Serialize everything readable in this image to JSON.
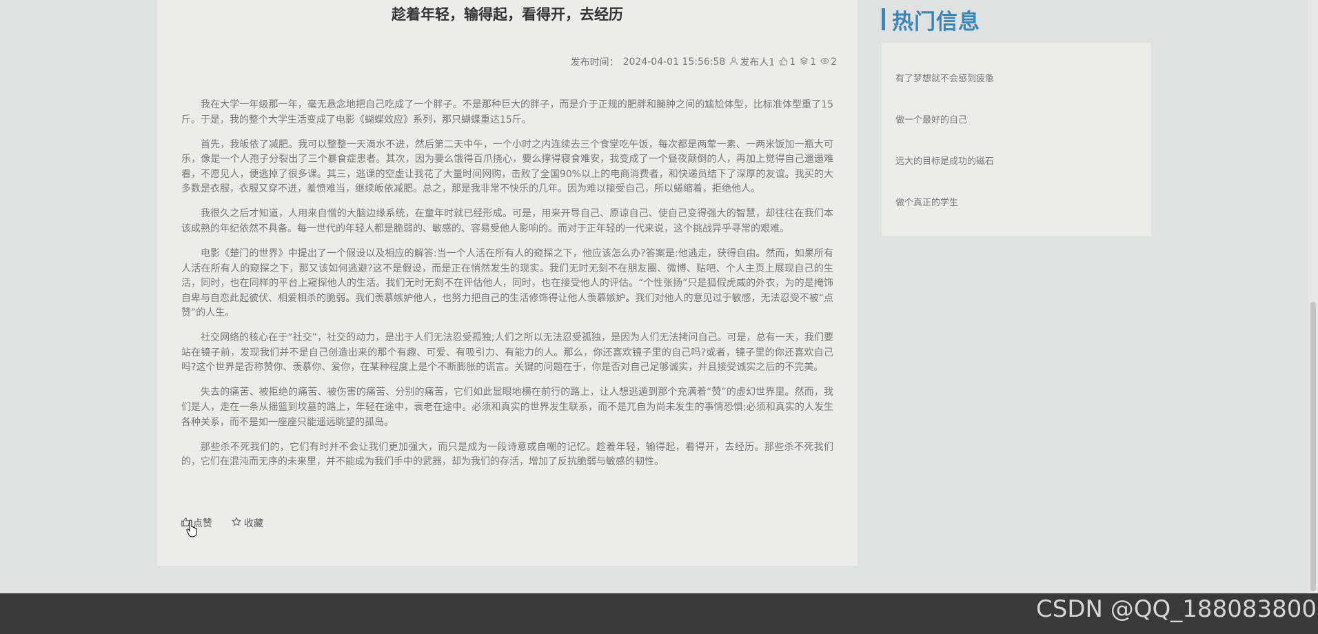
{
  "article": {
    "title": "趁着年轻，输得起，看得开，去经历",
    "meta": {
      "publish_label": "发布时间：",
      "publish_time": "2024-04-01 15:56:58",
      "publisher": "发布人1",
      "likes": "1",
      "comments": "1",
      "views": "2"
    },
    "paragraphs": [
      "我在大学一年级那一年，毫无悬念地把自己吃成了一个胖子。不是那种巨大的胖子，而是介于正规的肥胖和臃肿之间的尴尬体型，比标准体型重了15斤。于是，我的整个大学生活变成了电影《蝴蝶效应》系列，那只蝴蝶重达15斤。",
      "首先，我皈依了减肥。我可以整整一天滴水不进，然后第二天中午，一个小时之内连续去三个食堂吃午饭，每次都是两荤一素、一两米饭加一瓶大可乐，像是一个人孢子分裂出了三个暴食症患者。其次，因为要么饿得百爪挠心，要么撑得寝食难安，我变成了一个昼夜颠倒的人，再加上觉得自己邋遢难看，不愿见人，便逃掉了很多课。其三，逃课的空虚让我花了大量时间网购，击败了全国90%以上的电商消费者，和快递员结下了深厚的友谊。我买的大多数是衣服，衣服又穿不进，羞愤难当，继续皈依减肥。总之，那是我非常不快乐的几年。因为难以接受自己，所以蜷缩着，拒绝他人。",
      "我很久之后才知道，人用来自憎的大脑边缘系统，在童年时就已经形成。可是，用来开导自己、原谅自己、使自己变得强大的智慧，却往往在我们本该成熟的年纪依然不具备。每一世代的年轻人都是脆弱的、敏感的、容易受他人影响的。而对于正年轻的一代来说，这个挑战异乎寻常的艰难。",
      "电影《楚门的世界》中提出了一个假设以及相应的解答:当一个人活在所有人的窥探之下，他应该怎么办?答案是:他逃走，获得自由。然而，如果所有人活在所有人的窥探之下，那又该如何逃避?这不是假设，而是正在悄然发生的现实。我们无时无刻不在朋友圈、微博、贴吧、个人主页上展现自己的生活，同时，也在同样的平台上窥探他人的生活。我们无时无刻不在评估他人，同时，也在接受他人的评估。“个性张扬”只是狐假虎威的外衣，为的是掩饰自卑与自恋此起彼伏、相爱相杀的脆弱。我们羡慕嫉妒他人，也努力把自己的生活修饰得让他人羡慕嫉妒。我们对他人的意见过于敏感，无法忍受不被“点赞”的人生。",
      "社交网络的核心在于“社交”，社交的动力，是出于人们无法忍受孤独;人们之所以无法忍受孤独，是因为人们无法拷问自己。可是，总有一天，我们要站在镜子前，发现我们并不是自己创造出来的那个有趣、可爱、有吸引力、有能力的人。那么，你还喜欢镜子里的自己吗?或者，镜子里的你还喜欢自己吗?这个世界是否称赞你、羡慕你、爱你，在某种程度上是个不断膨胀的谎言。关键的问题在于，你是否对自己足够诚实，并且接受诚实之后的不完美。",
      "失去的痛苦、被拒绝的痛苦、被伤害的痛苦、分别的痛苦，它们如此显眼地横在前行的路上，让人想逃遁到那个充满着“赞”的虚幻世界里。然而，我们是人，走在一条从摇篮到坟墓的路上，年轻在途中，衰老在途中。必须和真实的世界发生联系，而不是兀自为尚未发生的事情恐惧;必须和真实的人发生各种关系，而不是如一座座只能遥远眺望的孤岛。",
      "那些杀不死我们的，它们有时并不会让我们更加强大，而只是成为一段诗意或自嘲的记忆。趁着年轻，输得起，看得开，去经历。那些杀不死我们的，它们在混沌而无序的未来里，并不能成为我们手中的武器，却为我们的存活，增加了反抗脆弱与敏感的韧性。"
    ],
    "actions": {
      "like_label": "点赞",
      "favorite_label": "收藏"
    }
  },
  "sidebar": {
    "heading": "热门信息",
    "items": [
      "有了梦想就不会感到疲惫",
      "做一个最好的自己",
      "远大的目标是成功的磁石",
      "做个真正的学生"
    ]
  },
  "watermark": "CSDN @QQ_188083800",
  "colors": {
    "accent": "#3a86b8",
    "footer": "#393939",
    "card": "#ececeb",
    "page_bg": "#e0e2e2"
  }
}
